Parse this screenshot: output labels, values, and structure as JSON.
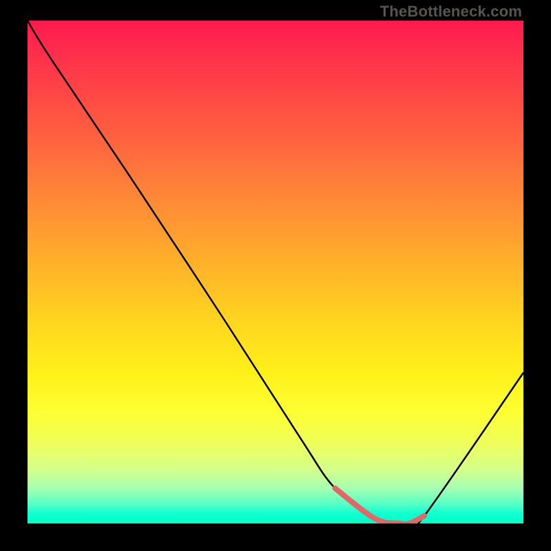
{
  "watermark": "TheBottleneck.com",
  "chart_data": {
    "type": "line",
    "title": "",
    "xlabel": "",
    "ylabel": "",
    "xlim": [
      0,
      100
    ],
    "ylim": [
      0,
      100
    ],
    "background_gradient": {
      "top": "#ff1a4d",
      "mid": "#ffe01f",
      "bottom": "#00ffc4"
    },
    "series": [
      {
        "name": "curve",
        "color": "#000000",
        "x": [
          0,
          5,
          22,
          40,
          55,
          62,
          70,
          75,
          77,
          80,
          100
        ],
        "values": [
          100,
          92,
          67,
          40,
          17,
          7,
          1,
          0,
          0,
          1.5,
          30
        ]
      },
      {
        "name": "highlight-band",
        "color": "#e06868",
        "x": [
          62,
          70,
          75,
          77,
          80
        ],
        "values": [
          7,
          1,
          0,
          0,
          1.5
        ]
      }
    ]
  }
}
